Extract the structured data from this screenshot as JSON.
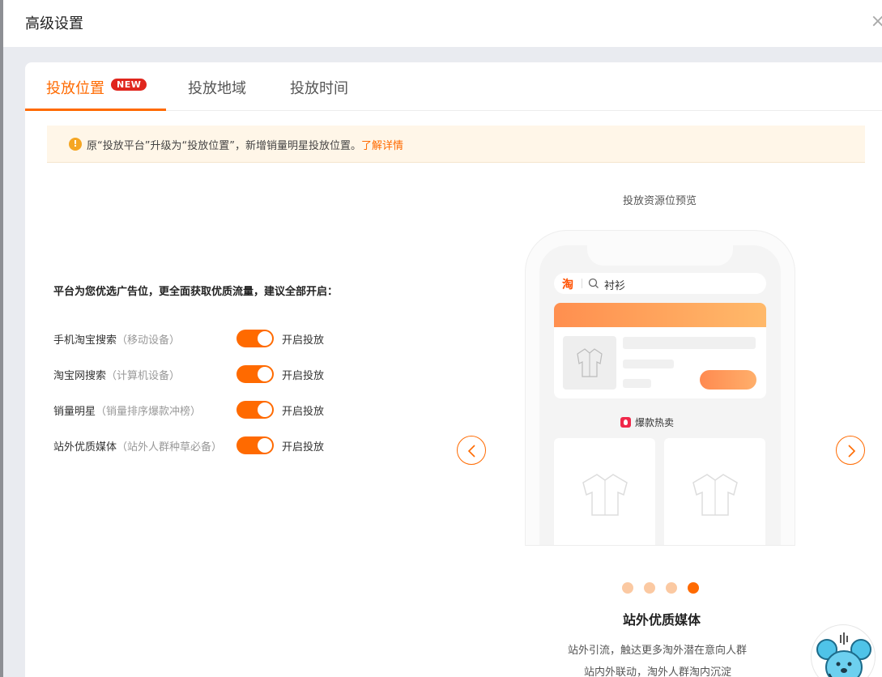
{
  "modal": {
    "title": "高级设置",
    "close_glyph": "×"
  },
  "tabs": [
    {
      "label": "投放位置",
      "badge": "NEW",
      "active": true
    },
    {
      "label": "投放地域",
      "active": false
    },
    {
      "label": "投放时间",
      "active": false
    }
  ],
  "notice": {
    "icon": "!",
    "text": "原“投放平台”升级为“投放位置”，新增销量明星投放位置。",
    "link": "了解详情"
  },
  "settings": {
    "intro": "平台为您优选广告位，更全面获取优质流量，建议全部开启：",
    "rows": [
      {
        "label": "手机淘宝搜索",
        "sub": "（移动设备）",
        "status": "开启投放",
        "on": true
      },
      {
        "label": "淘宝网搜索",
        "sub": "（计算机设备）",
        "status": "开启投放",
        "on": true
      },
      {
        "label": "销量明星",
        "sub": "（销量排序爆款冲榜）",
        "status": "开启投放",
        "on": true
      },
      {
        "label": "站外优质媒体",
        "sub": "（站外人群种草必备）",
        "status": "开启投放",
        "on": true
      }
    ]
  },
  "preview": {
    "title": "投放资源位预览",
    "phone": {
      "app_icon_text": "淘",
      "search_query": "衬衫",
      "section_label": "爆款热卖"
    },
    "slides_count": 4,
    "active_slide": 4,
    "slide_title": "站外优质媒体",
    "slide_desc_1": "站外引流，触达更多淘外潜在意向人群",
    "slide_desc_2": "站内外联动，淘外人群淘内沉淀"
  },
  "colors": {
    "accent": "#ff6a00",
    "badge_red": "#e0261d",
    "notice_bg": "#fff6e8",
    "dot_inactive": "#fbc9a2"
  },
  "icons": [
    "warning-icon",
    "chevron-left-icon",
    "chevron-right-icon",
    "search-icon",
    "shirt-icon",
    "hot-icon",
    "assistant-mascot-icon",
    "close-icon"
  ]
}
